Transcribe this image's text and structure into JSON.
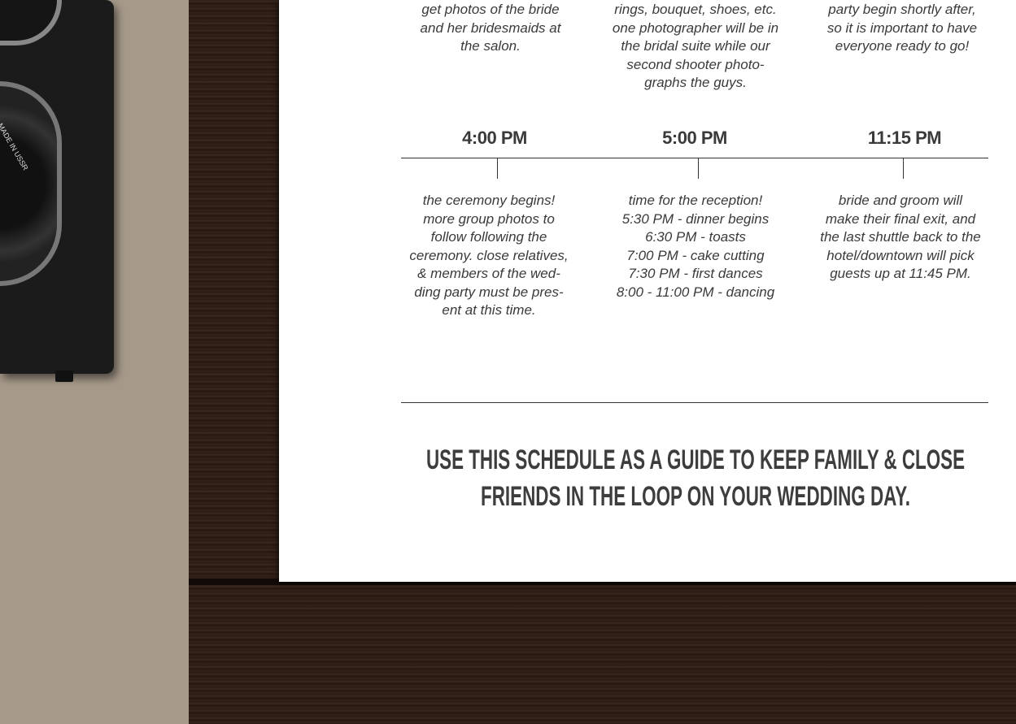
{
  "top_columns": [
    {
      "lines": [
        "get photos of the bride",
        "and her bridesmaids at",
        "the salon."
      ]
    },
    {
      "lines": [
        "rings, bouquet, shoes, etc.",
        "one photographer will be in",
        "the bridal suite while our",
        "second shooter photo-",
        "graphs the guys."
      ]
    },
    {
      "lines": [
        "party begin shortly after,",
        "so it is important to have",
        "everyone ready to go!"
      ]
    }
  ],
  "timeline": [
    {
      "time": "4:00 PM",
      "lines": [
        "the ceremony begins!",
        "more group photos to",
        "follow following the",
        "ceremony. close relatives,",
        "& members of the wed-",
        "ding party must be pres-",
        "ent at this time."
      ]
    },
    {
      "time": "5:00 PM",
      "lines": [
        "time for the reception!",
        "5:30 PM - dinner begins",
        "6:30 PM - toasts",
        "7:00 PM - cake cutting",
        "7:30 PM - first dances",
        "8:00 - 11:00 PM - dancing"
      ]
    },
    {
      "time": "11:15 PM",
      "lines": [
        "bride and groom will",
        "make their final exit, and",
        "the last shuttle back to the",
        "hotel/downtown will pick",
        "guests up at 11:45 PM."
      ]
    }
  ],
  "footer": {
    "lines": [
      "USE THIS SCHEDULE AS A GUIDE TO KEEP FAMILY & CLOSE",
      "FRIENDS IN THE LOOP ON YOUR WEDDING DAY."
    ]
  },
  "camera": {
    "lens_text": "MADE IN USSR"
  }
}
